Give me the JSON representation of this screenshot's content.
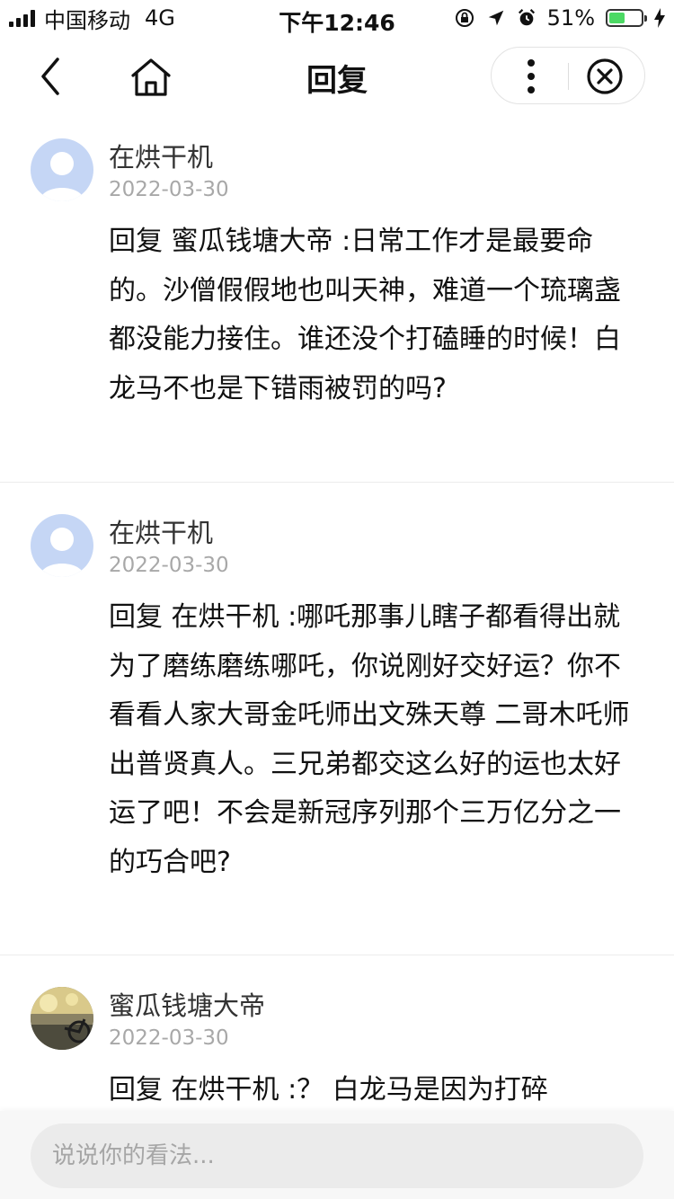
{
  "status_bar": {
    "carrier": "中国移动",
    "network": "4G",
    "time": "下午12:46",
    "battery_percent": "51%",
    "battery_level": 0.51,
    "battery_color": "#4cd964"
  },
  "nav": {
    "title": "回复",
    "back_icon": "chevron-left-icon",
    "home_icon": "home-icon",
    "more_icon": "more-vertical-icon",
    "close_icon": "close-circle-icon"
  },
  "comments": [
    {
      "name": "在烘干机",
      "date": "2022-03-30",
      "avatar": "default-avatar",
      "text": "回复 蜜瓜钱塘大帝 :日常工作才是最要命的。沙僧假假地也叫天神，难道一个琉璃盏都没能力接住。谁还没个打磕睡的时候！白龙马不也是下错雨被罚的吗?"
    },
    {
      "name": "在烘干机",
      "date": "2022-03-30",
      "avatar": "default-avatar",
      "text": "回复 在烘干机 :哪吒那事儿瞎子都看得出就为了磨练磨练哪吒，你说刚好交好运？你不看看人家大哥金吒师出文殊天尊 二哥木吒师出普贤真人。三兄弟都交这么好的运也太好运了吧！不会是新冠序列那个三万亿分之一的巧合吧?"
    },
    {
      "name": "蜜瓜钱塘大帝",
      "date": "2022-03-30",
      "avatar": "photo-avatar",
      "text": "回复 在烘干机 :？ 白龙马是因为打碎"
    }
  ],
  "input": {
    "placeholder": "说说你的看法..."
  }
}
